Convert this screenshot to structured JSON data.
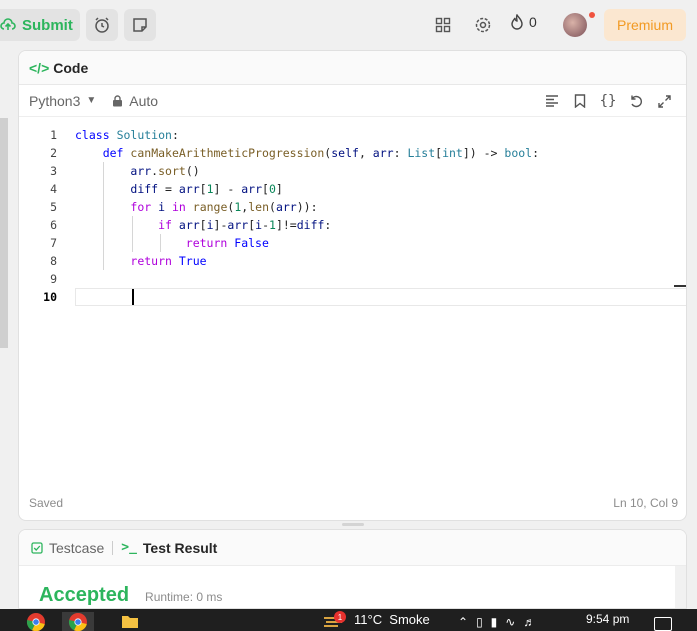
{
  "topbar": {
    "submit_label": "Submit",
    "streak_count": "0",
    "premium_label": "Premium"
  },
  "panel": {
    "title": "Code",
    "language": "Python3",
    "mode": "Auto",
    "status_left": "Saved",
    "status_right": "Ln 10, Col 9"
  },
  "editor": {
    "line_numbers": [
      "1",
      "2",
      "3",
      "4",
      "5",
      "6",
      "7",
      "8",
      "9",
      "10"
    ],
    "active_line": "10"
  },
  "bottom": {
    "tab_testcase": "Testcase",
    "tab_result": "Test Result",
    "result": "Accepted",
    "runtime": "Runtime: 0 ms"
  },
  "taskbar": {
    "weather": "11°C  Smoke",
    "badge": "1",
    "time": "9:54 pm"
  },
  "colors": {
    "accent_green": "#2db55d",
    "premium": "#f29a23"
  }
}
